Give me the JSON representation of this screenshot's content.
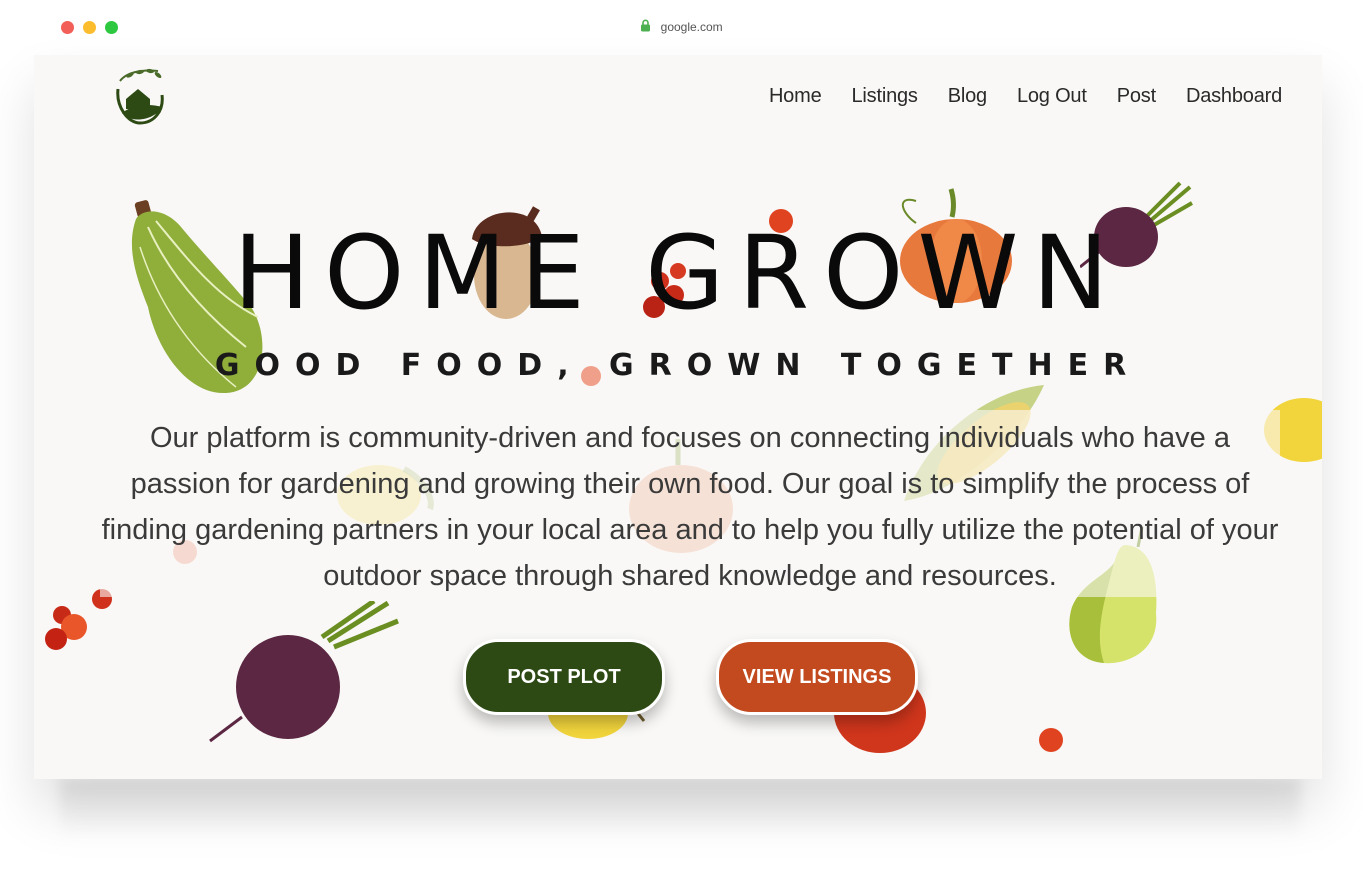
{
  "browser": {
    "url": "google.com"
  },
  "nav": {
    "items": [
      "Home",
      "Listings",
      "Blog",
      "Log Out",
      "Post",
      "Dashboard"
    ]
  },
  "hero": {
    "title": "HOME GROWN",
    "subtitle": "GOOD FOOD, GROWN TOGETHER",
    "description": "Our platform is community-driven and focuses on connecting individuals who have a passion for gardening and growing their own food. Our goal is to simplify the process of finding gardening partners in your local area and to help you fully utilize the potential of your outdoor space through shared knowledge and resources."
  },
  "buttons": {
    "post_plot": "POST PLOT",
    "view_listings": "VIEW LISTINGS"
  },
  "colors": {
    "brand_green": "#2d4a14",
    "brand_orange": "#c24a1e",
    "background": "#f9f8f6"
  },
  "icons": {
    "logo": "garden-house-logo-icon",
    "lock": "lock-icon"
  }
}
